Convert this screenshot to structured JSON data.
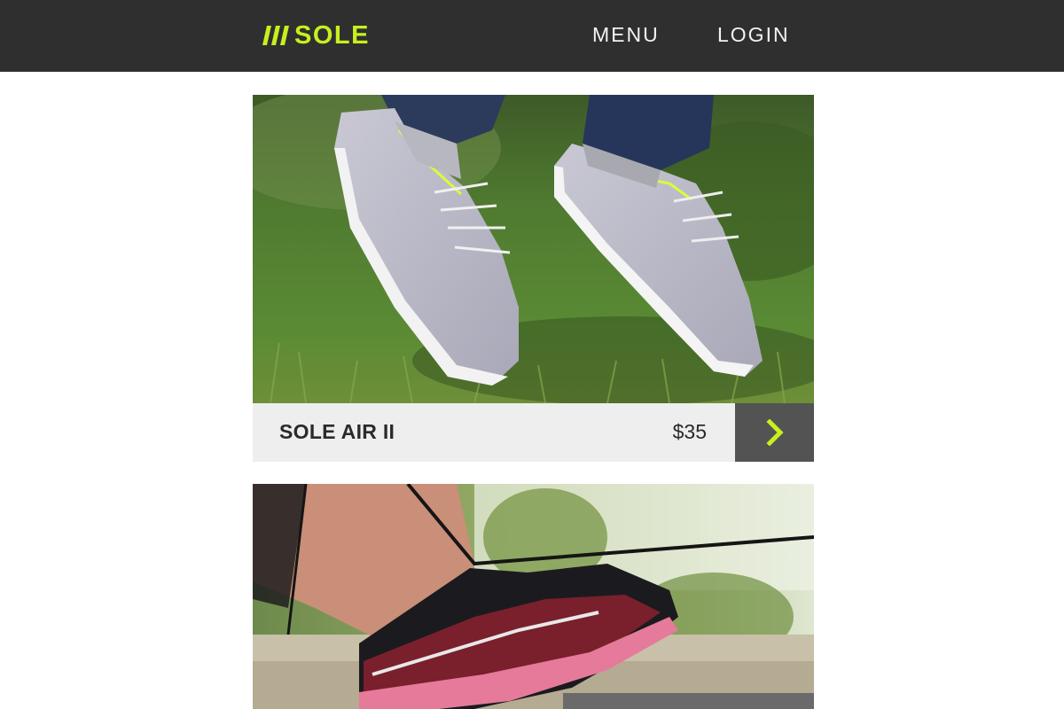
{
  "header": {
    "brand": "SOLE",
    "nav": {
      "menu": "MENU",
      "login": "LOGIN"
    }
  },
  "products": [
    {
      "name": "SOLE AIR II",
      "price": "$35"
    }
  ],
  "colors": {
    "header_bg": "#2f2f2f",
    "accent": "#c6f01e",
    "info_bar_bg": "#eeeeee",
    "button_bg": "#535353"
  },
  "icons": {
    "logo": "slashes-logo-icon",
    "next": "chevron-right-icon"
  }
}
